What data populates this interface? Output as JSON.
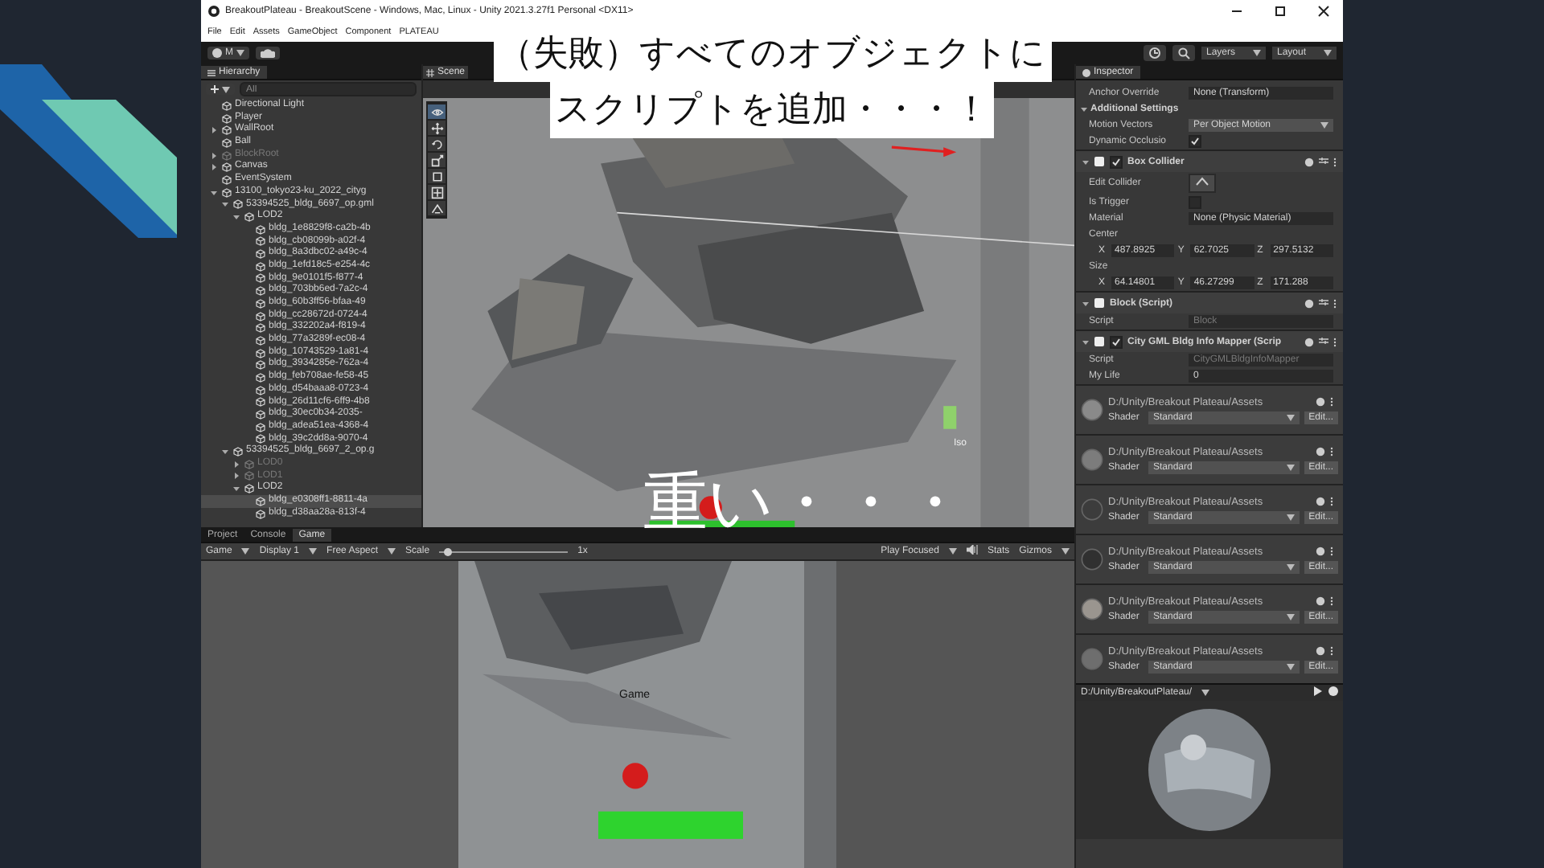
{
  "overlays": [
    {
      "kind": "callout",
      "lines": [
        "（失敗）すべてのオブジェクトに",
        "スクリプトを追加・・・！"
      ]
    },
    {
      "kind": "caption",
      "lines": [
        "重い・・・"
      ]
    }
  ],
  "window": {
    "title": "BreakoutPlateau - BreakoutScene - Windows, Mac, Linux - Unity 2021.3.27f1 Personal <DX11>",
    "menu": [
      "File",
      "Edit",
      "Assets",
      "GameObject",
      "Component",
      "PLATEAU"
    ]
  },
  "toolbar": {
    "account": "M",
    "layers": "Layers",
    "layout": "Layout"
  },
  "hierarchy": {
    "title": "Hierarchy",
    "search_placeholder": "All",
    "items": [
      {
        "label": "Directional Light",
        "disabled": false,
        "selected": false
      },
      {
        "label": "Player",
        "disabled": false,
        "selected": false
      },
      {
        "label": "WallRoot",
        "disabled": false,
        "selected": false,
        "expanded": false
      },
      {
        "label": "Ball",
        "disabled": false,
        "selected": false
      },
      {
        "label": "BlockRoot",
        "disabled": true,
        "selected": false,
        "expanded": false
      },
      {
        "label": "Canvas",
        "disabled": false,
        "selected": false,
        "expanded": false
      },
      {
        "label": "EventSystem",
        "disabled": false,
        "selected": false
      },
      {
        "label": "13100_tokyo23-ku_2022_cityg",
        "disabled": false,
        "selected": false,
        "expanded": true,
        "children": [
          {
            "label": "53394525_bldg_6697_op.gml",
            "disabled": false,
            "selected": false,
            "expanded": true,
            "children": [
              {
                "label": "LOD2",
                "disabled": false,
                "selected": false,
                "expanded": true,
                "children": [
                  {
                    "label": "bldg_1e8829f8-ca2b-4b",
                    "disabled": false,
                    "selected": false
                  },
                  {
                    "label": "bldg_cb08099b-a02f-4",
                    "disabled": false,
                    "selected": false
                  },
                  {
                    "label": "bldg_8a3dbc02-a49c-4",
                    "disabled": false,
                    "selected": false
                  },
                  {
                    "label": "bldg_1efd18c5-e254-4c",
                    "disabled": false,
                    "selected": false
                  },
                  {
                    "label": "bldg_9e0101f5-f877-4",
                    "disabled": false,
                    "selected": false
                  },
                  {
                    "label": "bldg_703bb6ed-7a2c-4",
                    "disabled": false,
                    "selected": false
                  },
                  {
                    "label": "bldg_60b3ff56-bfaa-49",
                    "disabled": false,
                    "selected": false
                  },
                  {
                    "label": "bldg_cc28672d-0724-4",
                    "disabled": false,
                    "selected": false
                  },
                  {
                    "label": "bldg_332202a4-f819-4",
                    "disabled": false,
                    "selected": false
                  },
                  {
                    "label": "bldg_77a3289f-ec08-4",
                    "disabled": false,
                    "selected": false
                  },
                  {
                    "label": "bldg_10743529-1a81-4",
                    "disabled": false,
                    "selected": false
                  },
                  {
                    "label": "bldg_3934285e-762a-4",
                    "disabled": false,
                    "selected": false
                  },
                  {
                    "label": "bldg_feb708ae-fe58-45",
                    "disabled": false,
                    "selected": false
                  },
                  {
                    "label": "bldg_d54baaa8-0723-4",
                    "disabled": false,
                    "selected": false
                  },
                  {
                    "label": "bldg_26d11cf6-6ff9-4b8",
                    "disabled": false,
                    "selected": false
                  },
                  {
                    "label": "bldg_30ec0b34-2035-",
                    "disabled": false,
                    "selected": false
                  },
                  {
                    "label": "bldg_adea51ea-4368-4",
                    "disabled": false,
                    "selected": false
                  },
                  {
                    "label": "bldg_39c2dd8a-9070-4",
                    "disabled": false,
                    "selected": false
                  }
                ]
              }
            ]
          },
          {
            "label": "53394525_bldg_6697_2_op.g",
            "disabled": false,
            "selected": false,
            "expanded": true,
            "children": [
              {
                "label": "LOD0",
                "disabled": true,
                "selected": false,
                "expanded": false
              },
              {
                "label": "LOD1",
                "disabled": true,
                "selected": false,
                "expanded": false
              },
              {
                "label": "LOD2",
                "disabled": false,
                "selected": false,
                "expanded": true,
                "children": [
                  {
                    "label": "bldg_e0308ff1-8811-4a",
                    "disabled": false,
                    "selected": true
                  },
                  {
                    "label": "bldg_d38aa28a-813f-4",
                    "disabled": false,
                    "selected": false
                  }
                ]
              }
            ]
          }
        ]
      }
    ]
  },
  "scene": {
    "tab": "Scene",
    "gizmo_label": "Iso",
    "tools": [
      {
        "kind": "view",
        "selected": true
      },
      {
        "kind": "move",
        "selected": false
      },
      {
        "kind": "rotate",
        "selected": false
      },
      {
        "kind": "scale",
        "selected": false
      },
      {
        "kind": "rect",
        "selected": false
      },
      {
        "kind": "transform",
        "selected": false
      },
      {
        "kind": "custom",
        "selected": false
      }
    ]
  },
  "inspector": {
    "title": "Inspector",
    "rows": [
      {
        "kind": "field",
        "label": "Anchor Override",
        "value": "None (Transform)",
        "disabled": false
      },
      {
        "kind": "section",
        "label": "Additional Settings",
        "expanded": true
      },
      {
        "kind": "dropdown",
        "label": "Motion Vectors",
        "value": "Per Object Motion"
      },
      {
        "kind": "checkbox",
        "label": "Dynamic Occlusio",
        "checked": true
      },
      {
        "kind": "component",
        "label": "Box Collider",
        "enabled": true,
        "expanded": true
      },
      {
        "kind": "button",
        "label": "Edit Collider"
      },
      {
        "kind": "checkbox",
        "label": "Is Trigger",
        "checked": false
      },
      {
        "kind": "field",
        "label": "Material",
        "value": "None (Physic Material)",
        "disabled": false
      },
      {
        "kind": "label",
        "label": "Center"
      },
      {
        "kind": "vector",
        "values": [
          {
            "axis": "X",
            "value": "487.8925"
          },
          {
            "axis": "Y",
            "value": "62.7025"
          },
          {
            "axis": "Z",
            "value": "297.5132"
          }
        ]
      },
      {
        "kind": "label",
        "label": "Size"
      },
      {
        "kind": "vector",
        "values": [
          {
            "axis": "X",
            "value": "64.14801"
          },
          {
            "axis": "Y",
            "value": "46.27299"
          },
          {
            "axis": "Z",
            "value": "171.288"
          }
        ]
      },
      {
        "kind": "component",
        "label": "Block (Script)",
        "expanded": true
      },
      {
        "kind": "field",
        "label": "Script",
        "value": "Block",
        "disabled": true
      },
      {
        "kind": "component",
        "label": "City GML Bldg Info Mapper (Scrip",
        "enabled": true,
        "expanded": true
      },
      {
        "kind": "field",
        "label": "Script",
        "value": "CityGMLBldgInfoMapper",
        "disabled": true
      },
      {
        "kind": "field",
        "label": "My Life",
        "value": "0",
        "disabled": false
      }
    ],
    "materials": [
      {
        "path": "D:/Unity/Breakout Plateau/Assets",
        "shader_label": "Shader",
        "shader": "Standard",
        "edit": "Edit...",
        "color": "#8a8a8a"
      },
      {
        "path": "D:/Unity/Breakout Plateau/Assets",
        "shader_label": "Shader",
        "shader": "Standard",
        "edit": "Edit...",
        "color": "#7c7c7c"
      },
      {
        "path": "D:/Unity/Breakout Plateau/Assets",
        "shader_label": "Shader",
        "shader": "Standard",
        "edit": "Edit...",
        "color": "#3c3c3c"
      },
      {
        "path": "D:/Unity/Breakout Plateau/Assets",
        "shader_label": "Shader",
        "shader": "Standard",
        "edit": "Edit...",
        "color": "#303030"
      },
      {
        "path": "D:/Unity/Breakout Plateau/Assets",
        "shader_label": "Shader",
        "shader": "Standard",
        "edit": "Edit...",
        "color": "#9a958f"
      },
      {
        "path": "D:/Unity/Breakout Plateau/Assets",
        "shader_label": "Shader",
        "shader": "Standard",
        "edit": "Edit...",
        "color": "#6e6e6e"
      }
    ],
    "preview": {
      "path": "D:/Unity/BreakoutPlateau/"
    }
  },
  "bottom_tabs": [
    {
      "label": "Project",
      "selected": false
    },
    {
      "label": "Console",
      "selected": false
    },
    {
      "label": "Game",
      "selected": true
    }
  ],
  "game_toolbar": {
    "view": "Game",
    "display": "Display 1",
    "aspect": "Free Aspect",
    "scale_label": "Scale",
    "scale": {
      "level": 0.04
    },
    "scale_value": "1x",
    "play_mode": "Play Focused",
    "stats": "Stats",
    "gizmos": "Gizmos"
  },
  "game_view": {
    "label": "Game"
  }
}
